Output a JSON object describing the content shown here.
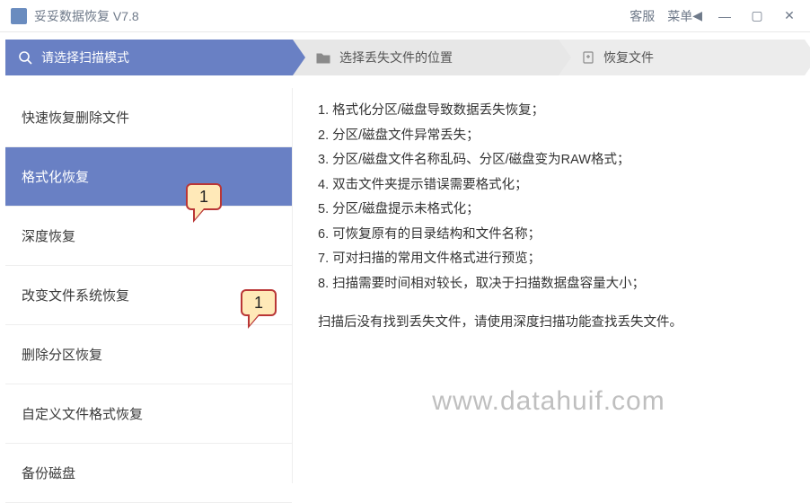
{
  "titlebar": {
    "title": "妥妥数据恢复 V7.8",
    "customer_service": "客服",
    "menu": "菜单"
  },
  "steps": {
    "s1": "请选择扫描模式",
    "s2": "选择丢失文件的位置",
    "s3": "恢复文件"
  },
  "sidebar": {
    "items": [
      {
        "label": "快速恢复删除文件"
      },
      {
        "label": "格式化恢复"
      },
      {
        "label": "深度恢复"
      },
      {
        "label": "改变文件系统恢复"
      },
      {
        "label": "删除分区恢复"
      },
      {
        "label": "自定义文件格式恢复"
      },
      {
        "label": "备份磁盘"
      }
    ]
  },
  "main": {
    "lines": [
      "1. 格式化分区/磁盘导致数据丢失恢复；",
      "2. 分区/磁盘文件异常丢失；",
      "3. 分区/磁盘文件名称乱码、分区/磁盘变为RAW格式；",
      "4. 双击文件夹提示错误需要格式化；",
      "5. 分区/磁盘提示未格式化；",
      "6. 可恢复原有的目录结构和文件名称；",
      "7. 可对扫描的常用文件格式进行预览；",
      "8. 扫描需要时间相对较长，取决于扫描数据盘容量大小；"
    ],
    "note": "扫描后没有找到丢失文件，请使用深度扫描功能查找丢失文件。",
    "watermark": "www.datahuif.com"
  },
  "callouts": {
    "a": "1",
    "b": "1"
  }
}
